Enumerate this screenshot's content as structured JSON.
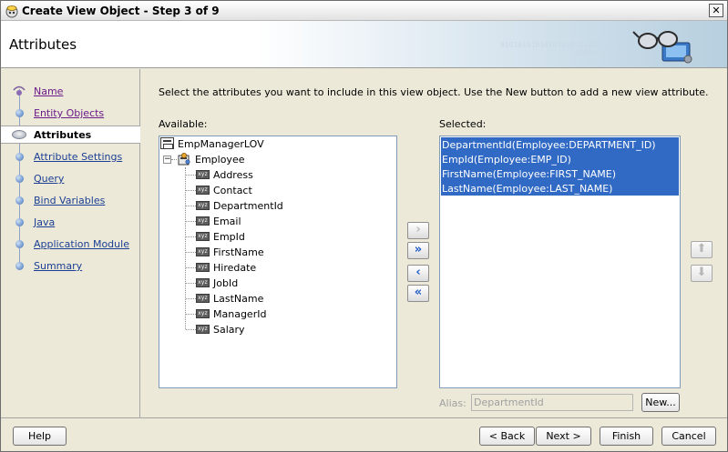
{
  "window": {
    "title": "Create View Object - Step 3 of 9",
    "close_glyph": "✕"
  },
  "header": {
    "title": "Attributes",
    "binary_text_1": "01010101010101010101010101",
    "binary_text_2": "01010101010"
  },
  "nav": {
    "items": [
      {
        "label": "Name",
        "state": "visited"
      },
      {
        "label": "Entity Objects",
        "state": "visited"
      },
      {
        "label": "Attributes",
        "state": "current"
      },
      {
        "label": "Attribute Settings",
        "state": "link"
      },
      {
        "label": "Query",
        "state": "link"
      },
      {
        "label": "Bind Variables",
        "state": "link"
      },
      {
        "label": "Java",
        "state": "link"
      },
      {
        "label": "Application Module",
        "state": "link"
      },
      {
        "label": "Summary",
        "state": "link"
      }
    ]
  },
  "main": {
    "instructions": "Select the attributes you want to include in this view object.  Use the New button to add a new view attribute.",
    "available_label": "Available:",
    "selected_label": "Selected:",
    "available_tree": {
      "root": "EmpManagerLOV",
      "entity": "Employee",
      "expander": "−",
      "attribute_icon_text": "xyz",
      "attributes": [
        "Address",
        "Contact",
        "DepartmentId",
        "Email",
        "EmpId",
        "FirstName",
        "Hiredate",
        "JobId",
        "LastName",
        "ManagerId",
        "Salary"
      ]
    },
    "selected_items": [
      "DepartmentId(Employee:DEPARTMENT_ID)",
      "EmpId(Employee:EMP_ID)",
      "FirstName(Employee:FIRST_NAME)",
      "LastName(Employee:LAST_NAME)"
    ],
    "shuttle": {
      "add": "›",
      "add_all": "»",
      "remove": "‹",
      "remove_all": "«"
    },
    "order": {
      "up": "⬆",
      "down": "⬇"
    },
    "alias_label": "Alias:",
    "alias_value": "DepartmentId",
    "new_button": "New..."
  },
  "footer": {
    "help": "Help",
    "back": "< Back",
    "next": "Next >",
    "finish": "Finish",
    "cancel": "Cancel"
  },
  "colors": {
    "selection": "#316ac5",
    "link": "#1c3f94",
    "visited_link": "#6a1b8a",
    "shuttle_active": "#1f5cc6"
  }
}
